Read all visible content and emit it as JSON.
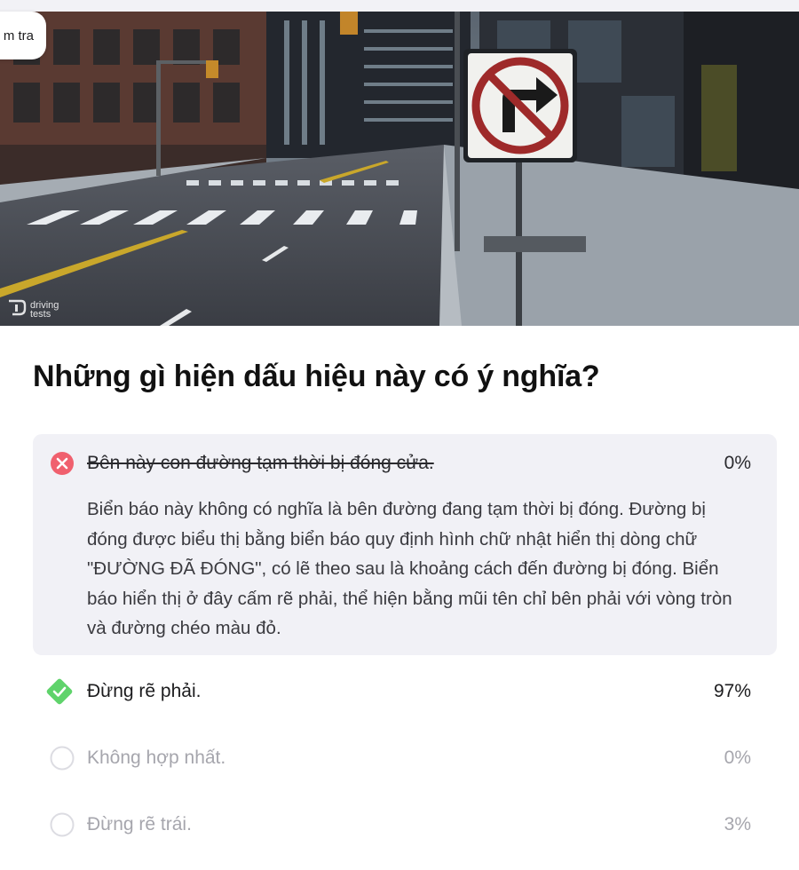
{
  "header": {
    "back_label": "m tra"
  },
  "hero": {
    "watermark_line1": "driving",
    "watermark_line2": "tests"
  },
  "question": {
    "title": "Những gì hiện dấu hiệu này có ý nghĩa?"
  },
  "answers": [
    {
      "label": "Bên này con đường tạm thời bị đóng cửa.",
      "percent": "0%",
      "state": "incorrect",
      "explanation": "Biển báo này không có nghĩa là bên đường đang tạm thời bị đóng. Đường bị đóng được biểu thị bằng biển báo quy định hình chữ nhật hiển thị dòng chữ \"ĐƯỜNG ĐÃ ĐÓNG\", có lẽ theo sau là khoảng cách đến đường bị đóng. Biển báo hiển thị ở đây cấm rẽ phải, thể hiện bằng mũi tên chỉ bên phải với vòng tròn và đường chéo màu đỏ."
    },
    {
      "label": "Đừng rẽ phải.",
      "percent": "97%",
      "state": "correct"
    },
    {
      "label": "Không hợp nhất.",
      "percent": "0%",
      "state": "unselected"
    },
    {
      "label": "Đừng rẽ trái.",
      "percent": "3%",
      "state": "unselected"
    }
  ],
  "colors": {
    "incorrect": "#f0606e",
    "correct": "#5fd36b",
    "card_bg": "#f1f1f6",
    "muted_text": "#a6a6ad"
  },
  "icons": {
    "incorrect": "x-circle-icon",
    "correct": "check-diamond-icon",
    "unselected": "empty-circle-icon"
  }
}
